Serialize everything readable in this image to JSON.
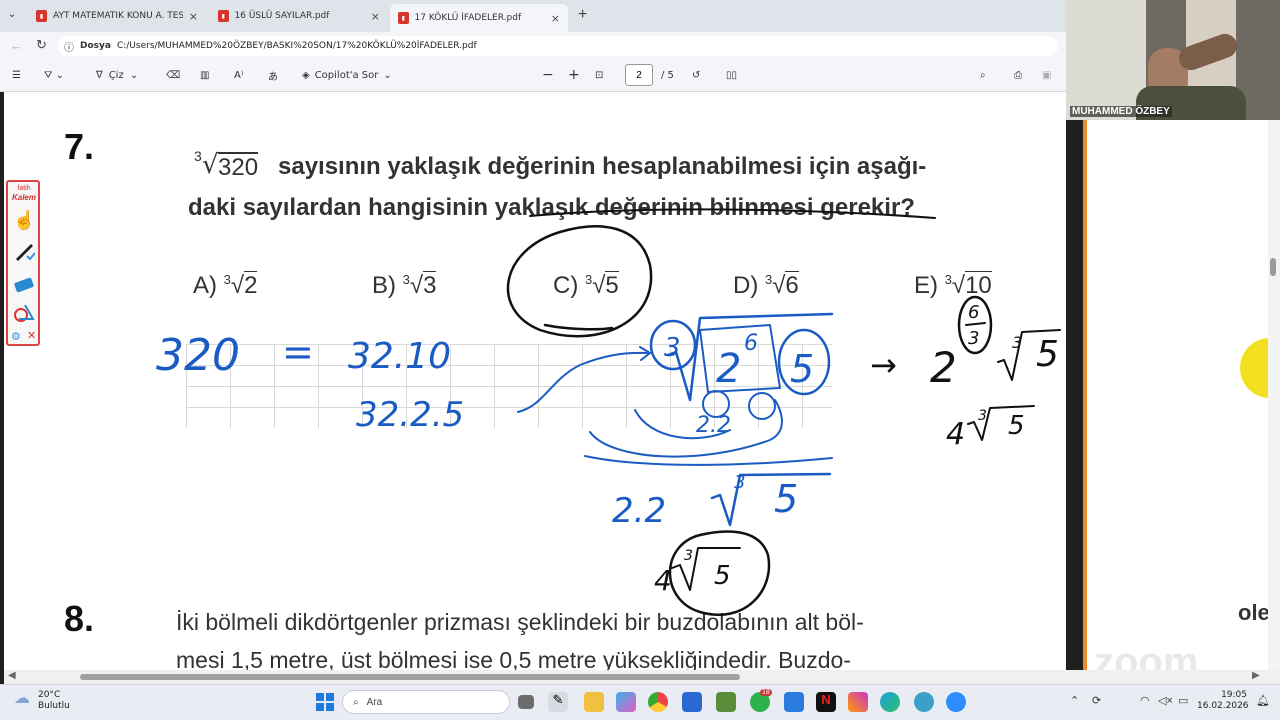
{
  "browser": {
    "tabs": [
      {
        "label": "AYT MATEMATİK KONU A. TESTOK"
      },
      {
        "label": "16 ÜSLÜ SAYILAR.pdf"
      },
      {
        "label": "17 KÖKLÜ İFADELER.pdf"
      }
    ],
    "address_label": "Dosya",
    "address": "C:/Users/MUHAMMED%20ÖZBEY/BASKI%20SON/17%20KÖKLÜ%20İFADELER.pdf"
  },
  "pdf_toolbar": {
    "draw_label": "Çiz",
    "copilot_label": "Copilot'a Sor",
    "page_current": "2",
    "page_total": "/ 5"
  },
  "webcam": {
    "name": "MUHAMMED ÖZBEY"
  },
  "kalem": {
    "brand_top": "fatih",
    "brand": "Kalem"
  },
  "question7": {
    "number": "7.",
    "radical_index": "3",
    "radicand": "320",
    "line1": "sayısının yaklaşık değerinin hesaplanabilmesi için aşağı-",
    "line2": "daki sayılardan hangisinin yaklaşık değerinin bilinmesi gerekir?",
    "options": [
      {
        "letter": "A)",
        "index": "3",
        "value": "2"
      },
      {
        "letter": "B)",
        "index": "3",
        "value": "3"
      },
      {
        "letter": "C)",
        "index": "3",
        "value": "5"
      },
      {
        "letter": "D)",
        "index": "3",
        "value": "6"
      },
      {
        "letter": "E)",
        "index": "3",
        "value": "10"
      }
    ]
  },
  "question8": {
    "number": "8.",
    "line1": "İki bölmeli dikdörtgenler prizması şeklindeki bir buzdolabının alt böl-",
    "line2": "mesi 1,5 metre, üst bölmesi ise 0,5 metre yüksekliğindedir. Buzdo-"
  },
  "handwriting": {
    "blue_l1a": "320",
    "blue_eq": "=",
    "blue_l1b": "32.10",
    "blue_l2": "32.2.5",
    "blue_root_in": "2",
    "blue_root_exp": "6",
    "blue_root_idx": "3",
    "blue_circ5": "5",
    "blue_small": "2.2",
    "blue_res": "2.2",
    "blue_res_idx": "3",
    "blue_res_rad": "5",
    "black_arrow": "→",
    "black_base": "2",
    "black_exp_top": "6",
    "black_exp_bot": "3",
    "black_idx": "3",
    "black_rad": "5",
    "black_res_coef": "4",
    "black_res_idx": "3",
    "black_res_rad": "5",
    "bottom_coef": "4",
    "bottom_idx": "3",
    "bottom_rad": "5"
  },
  "side_panel": {
    "fragment": "ole",
    "watermark": "zoom"
  },
  "taskbar": {
    "temperature": "20°C",
    "weather": "Bulutlu",
    "search_placeholder": "Ara",
    "time": "19:05",
    "date": "16.02.2026",
    "badge": "18"
  },
  "colors": {
    "accent_orange": "#e98c2e",
    "ink_blue": "#1a5bc4",
    "ink_black": "#111111",
    "kalem_red": "#d44444"
  }
}
